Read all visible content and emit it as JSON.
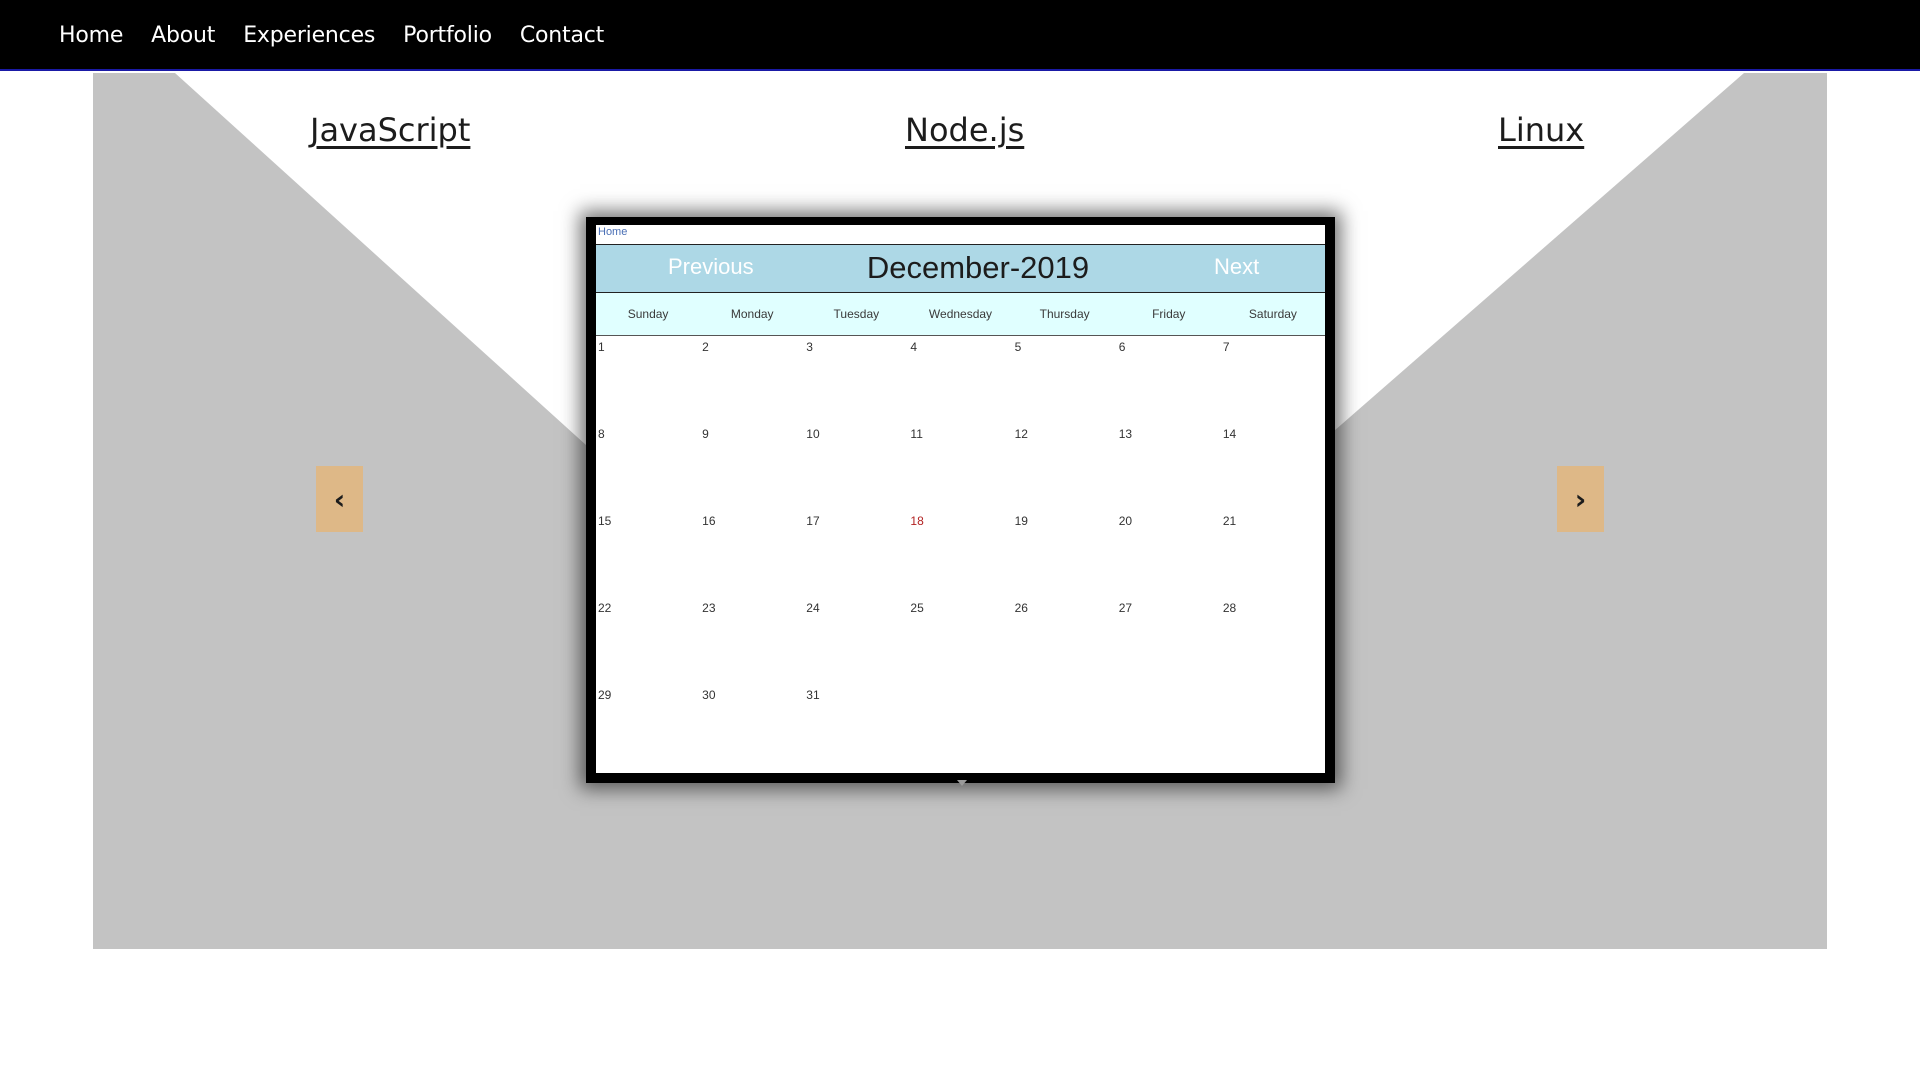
{
  "nav": {
    "items": [
      {
        "label": "Home"
      },
      {
        "label": "About"
      },
      {
        "label": "Experiences"
      },
      {
        "label": "Portfolio"
      },
      {
        "label": "Contact"
      }
    ]
  },
  "carousel": {
    "topics": {
      "javascript": "JavaScript",
      "nodejs": "Node.js",
      "linux": "Linux"
    },
    "prev_label": "‹",
    "next_label": "›",
    "background_color": "#c3c3c3",
    "button_color": "#deb887"
  },
  "calendar": {
    "home_link": "Home",
    "prev_label": "Previous",
    "next_label": "Next",
    "title": "December-2019",
    "header_color": "#add8e6",
    "weekday_bar_color": "#e0ffff",
    "weekdays": [
      "Sunday",
      "Monday",
      "Tuesday",
      "Wednesday",
      "Thursday",
      "Friday",
      "Saturday"
    ],
    "weeks": [
      [
        "1",
        "2",
        "3",
        "4",
        "5",
        "6",
        "7"
      ],
      [
        "8",
        "9",
        "10",
        "11",
        "12",
        "13",
        "14"
      ],
      [
        "15",
        "16",
        "17",
        "18",
        "19",
        "20",
        "21"
      ],
      [
        "22",
        "23",
        "24",
        "25",
        "26",
        "27",
        "28"
      ],
      [
        "29",
        "30",
        "31",
        "",
        "",
        "",
        ""
      ]
    ],
    "highlighted_day": "18",
    "highlight_color": "#b22222"
  }
}
